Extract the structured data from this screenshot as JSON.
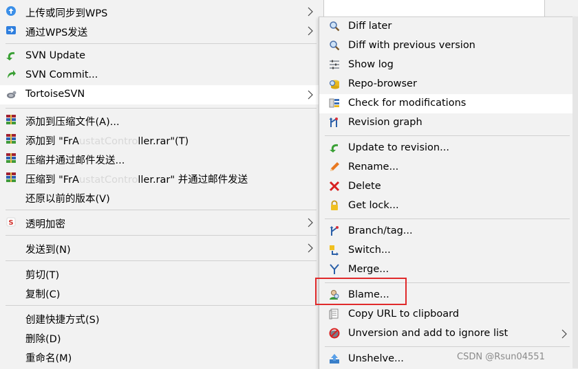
{
  "main_menu": {
    "upload_wps": "上传或同步到WPS",
    "send_wps": "通过WPS发送",
    "svn_update": "SVN Update",
    "svn_commit": "SVN Commit...",
    "tortoise_svn": "TortoiseSVN",
    "add_archive": "添加到压缩文件(A)...",
    "add_to_prefix": "添加到 \"FrA",
    "add_to_blur": "ustatContro",
    "add_to_suffix": "ller.rar\"(T)",
    "compress_email": "压缩并通过邮件发送...",
    "compress_to_prefix": "压缩到 \"FrA",
    "compress_to_blur": "ustatContro",
    "compress_to_suffix": "ller.rar\" 并通过邮件发送",
    "restore": "还原以前的版本(V)",
    "transparent_encrypt": "透明加密",
    "send_to": "发送到(N)",
    "cut": "剪切(T)",
    "copy": "复制(C)",
    "create_shortcut": "创建快捷方式(S)",
    "delete": "删除(D)",
    "rename": "重命名(M)"
  },
  "sub_menu": {
    "diff_later": "Diff later",
    "diff_previous": "Diff with previous version",
    "show_log": "Show log",
    "repo_browser": "Repo-browser",
    "check_modifications": "Check for modifications",
    "revision_graph": "Revision graph",
    "update_revision": "Update to revision...",
    "rename": "Rename...",
    "delete": "Delete",
    "get_lock": "Get lock...",
    "branch_tag": "Branch/tag...",
    "switch": "Switch...",
    "merge": "Merge...",
    "blame": "Blame...",
    "copy_url": "Copy URL to clipboard",
    "unversion": "Unversion and add to ignore list",
    "unshelve": "Unshelve..."
  },
  "watermark": "CSDN @Rsun04551",
  "colors": {
    "highlight": "#ffffff",
    "annotation_box": "#e0292a",
    "menu_bg": "#f2f2f2"
  }
}
